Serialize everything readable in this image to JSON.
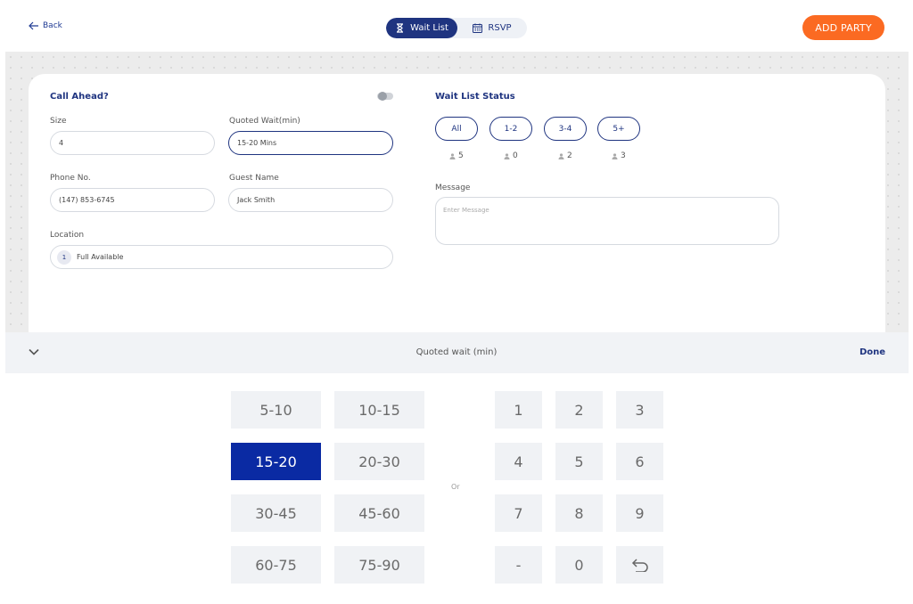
{
  "topbar": {
    "back_label": "Back",
    "tabs": [
      {
        "label": "Wait List",
        "icon": "hourglass-icon",
        "active": true
      },
      {
        "label": "RSVP",
        "icon": "calendar-icon",
        "active": false
      }
    ],
    "add_party_label": "ADD PARTY"
  },
  "form": {
    "call_ahead_title": "Call Ahead?",
    "call_ahead_enabled": false,
    "size_label": "Size",
    "size_value": "4",
    "quoted_wait_label": "Quoted Wait(min)",
    "quoted_wait_value": "15-20 Mins",
    "phone_label": "Phone No.",
    "phone_value": "(147) 853-6745",
    "guest_label": "Guest Name",
    "guest_value": "Jack Smith",
    "location_label": "Location",
    "location_badge": "1",
    "location_value": "Full Available"
  },
  "status": {
    "title": "Wait List Status",
    "filters": [
      {
        "label": "All",
        "count": "5"
      },
      {
        "label": "1-2",
        "count": "0"
      },
      {
        "label": "3-4",
        "count": "2"
      },
      {
        "label": "5+",
        "count": "3"
      }
    ],
    "message_label": "Message",
    "message_placeholder": "Enter Message"
  },
  "picker": {
    "title": "Quoted wait (min)",
    "done_label": "Done",
    "or_label": "Or",
    "ranges": [
      "5-10",
      "10-15",
      "15-20",
      "20-30",
      "30-45",
      "45-60",
      "60-75",
      "75-90"
    ],
    "selected_range": "15-20",
    "digits": [
      "1",
      "2",
      "3",
      "4",
      "5",
      "6",
      "7",
      "8",
      "9",
      "-",
      "0"
    ],
    "backspace_icon": "undo-icon"
  },
  "colors": {
    "primary": "#1f3480",
    "accent": "#fb6a22",
    "selected_key": "#0a2aa3"
  }
}
